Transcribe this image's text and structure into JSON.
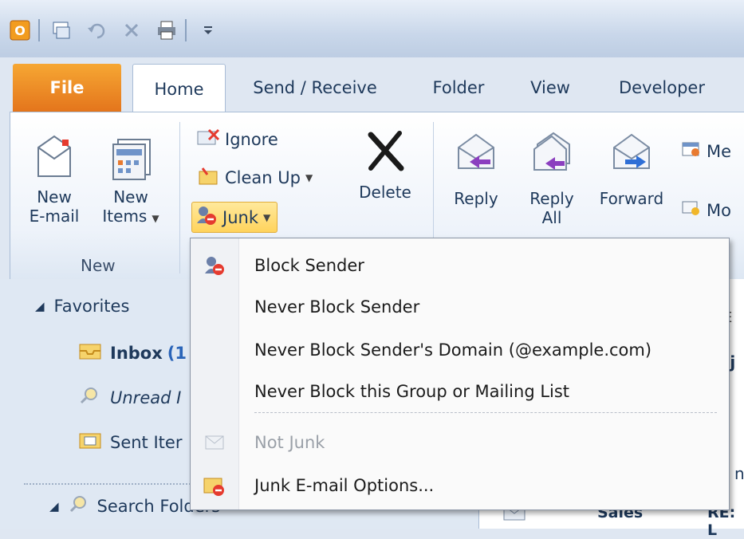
{
  "quick_access": {
    "icons": [
      "outlook-logo-icon",
      "send-receive-icon",
      "undo-icon",
      "delete-icon",
      "print-icon",
      "customize-icon"
    ],
    "logo_letter": "O"
  },
  "tabs": [
    {
      "label": "File"
    },
    {
      "label": "Home"
    },
    {
      "label": "Send / Receive"
    },
    {
      "label": "Folder"
    },
    {
      "label": "View"
    },
    {
      "label": "Developer"
    }
  ],
  "ribbon": {
    "new_email": {
      "line1": "New",
      "line2": "E-mail"
    },
    "new_items": {
      "line1": "New",
      "line2": "Items"
    },
    "group_new_label": "New",
    "ignore": "Ignore",
    "clean_up": "Clean Up",
    "junk": "Junk",
    "delete": "Delete",
    "reply": "Reply",
    "reply_all": {
      "line1": "Reply",
      "line2": "All"
    },
    "forward": "Forward",
    "meeting_partial": "Me",
    "more_partial": "Mo"
  },
  "nav": {
    "favorites": "Favorites",
    "inbox": "Inbox",
    "inbox_count_partial": "(1",
    "unread_partial": "Unread I",
    "sent_partial": "Sent Iter",
    "search_folders": "Search Folders"
  },
  "message_pane": {
    "partial_1": "E",
    "partial_2": "bj",
    "partial_3": "n",
    "sender_partial": "Sales",
    "subject_partial": "RE: L"
  },
  "junk_menu": {
    "items": [
      {
        "label": "Block Sender",
        "enabled": true,
        "icon": "block-sender-icon"
      },
      {
        "label": "Never Block Sender",
        "enabled": true
      },
      {
        "label": "Never Block Sender's Domain (@example.com)",
        "enabled": true
      },
      {
        "label": "Never Block this Group or Mailing List",
        "enabled": true
      },
      {
        "label": "Not Junk",
        "enabled": false,
        "icon": "not-junk-icon"
      },
      {
        "label": "Junk E-mail Options...",
        "enabled": true,
        "icon": "junk-options-icon"
      }
    ]
  },
  "colors": {
    "file_tab": "#e4751c",
    "junk_highlight": "#ffd35c",
    "ribbon_border": "#a8bcd6"
  }
}
